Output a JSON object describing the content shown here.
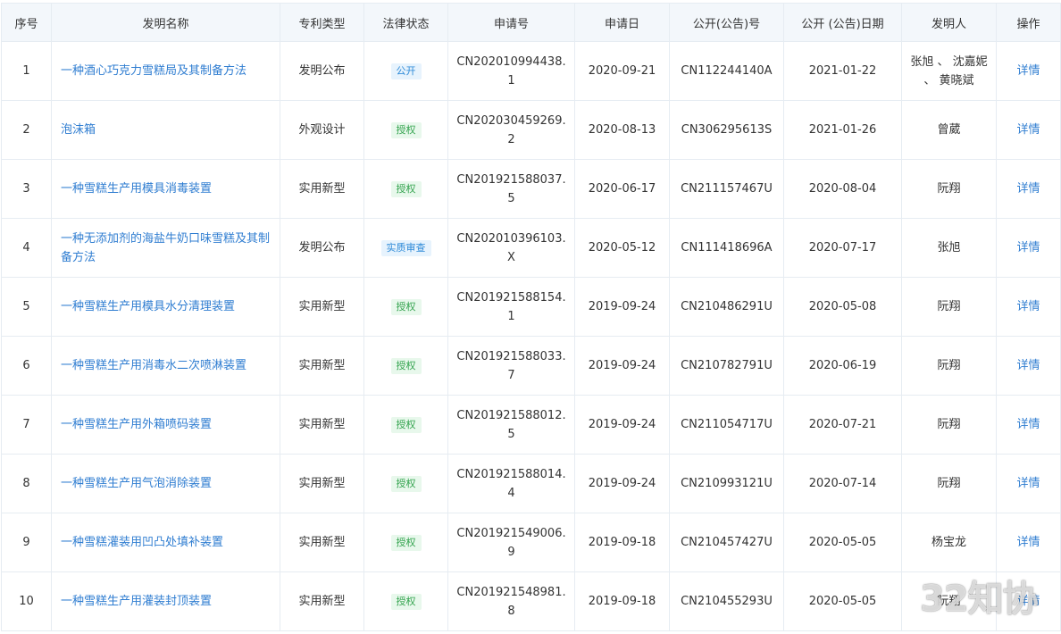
{
  "table": {
    "headers": [
      "序号",
      "发明名称",
      "专利类型",
      "法律状态",
      "申请号",
      "申请日",
      "公开(公告)号",
      "公开 (公告)日期",
      "发明人",
      "操作"
    ],
    "rows": [
      {
        "no": "1",
        "name": "一种酒心巧克力雪糕局及其制备方法",
        "type": "发明公布",
        "status": "公开",
        "app_no": "CN202010994438.1",
        "app_date": "2020-09-21",
        "pub_no": "CN112244140A",
        "pub_date": "2021-01-22",
        "inventor": "张旭 、 沈嘉妮 、 黄晓斌",
        "action": "详情"
      },
      {
        "no": "2",
        "name": "泡沫箱",
        "type": "外观设计",
        "status": "授权",
        "app_no": "CN202030459269.2",
        "app_date": "2020-08-13",
        "pub_no": "CN306295613S",
        "pub_date": "2021-01-26",
        "inventor": "曾葳",
        "action": "详情"
      },
      {
        "no": "3",
        "name": "一种雪糕生产用模具消毒装置",
        "type": "实用新型",
        "status": "授权",
        "app_no": "CN201921588037.5",
        "app_date": "2020-06-17",
        "pub_no": "CN211157467U",
        "pub_date": "2020-08-04",
        "inventor": "阮翔",
        "action": "详情"
      },
      {
        "no": "4",
        "name": "一种无添加剂的海盐牛奶口味雪糕及其制备方法",
        "type": "发明公布",
        "status": "实质审查",
        "app_no": "CN202010396103.X",
        "app_date": "2020-05-12",
        "pub_no": "CN111418696A",
        "pub_date": "2020-07-17",
        "inventor": "张旭",
        "action": "详情"
      },
      {
        "no": "5",
        "name": "一种雪糕生产用模具水分清理装置",
        "type": "实用新型",
        "status": "授权",
        "app_no": "CN201921588154.1",
        "app_date": "2019-09-24",
        "pub_no": "CN210486291U",
        "pub_date": "2020-05-08",
        "inventor": "阮翔",
        "action": "详情"
      },
      {
        "no": "6",
        "name": "一种雪糕生产用消毒水二次喷淋装置",
        "type": "实用新型",
        "status": "授权",
        "app_no": "CN201921588033.7",
        "app_date": "2019-09-24",
        "pub_no": "CN210782791U",
        "pub_date": "2020-06-19",
        "inventor": "阮翔",
        "action": "详情"
      },
      {
        "no": "7",
        "name": "一种雪糕生产用外箱喷码装置",
        "type": "实用新型",
        "status": "授权",
        "app_no": "CN201921588012.5",
        "app_date": "2019-09-24",
        "pub_no": "CN211054717U",
        "pub_date": "2020-07-21",
        "inventor": "阮翔",
        "action": "详情"
      },
      {
        "no": "8",
        "name": "一种雪糕生产用气泡消除装置",
        "type": "实用新型",
        "status": "授权",
        "app_no": "CN201921588014.4",
        "app_date": "2019-09-24",
        "pub_no": "CN210993121U",
        "pub_date": "2020-07-14",
        "inventor": "阮翔",
        "action": "详情"
      },
      {
        "no": "9",
        "name": "一种雪糕灌装用凹凸处填补装置",
        "type": "实用新型",
        "status": "授权",
        "app_no": "CN201921549006.9",
        "app_date": "2019-09-18",
        "pub_no": "CN210457427U",
        "pub_date": "2020-05-05",
        "inventor": "杨宝龙",
        "action": "详情"
      },
      {
        "no": "10",
        "name": "一种雪糕生产用灌装封顶装置",
        "type": "实用新型",
        "status": "授权",
        "app_no": "CN201921548981.8",
        "app_date": "2019-09-18",
        "pub_no": "CN210455293U",
        "pub_date": "2020-05-05",
        "inventor": "阮翔",
        "action": "详情"
      }
    ]
  },
  "status_colors": {
    "授权": "badge-green",
    "公开": "badge-blue",
    "实质审查": "badge-blue"
  },
  "watermark": "32知协"
}
